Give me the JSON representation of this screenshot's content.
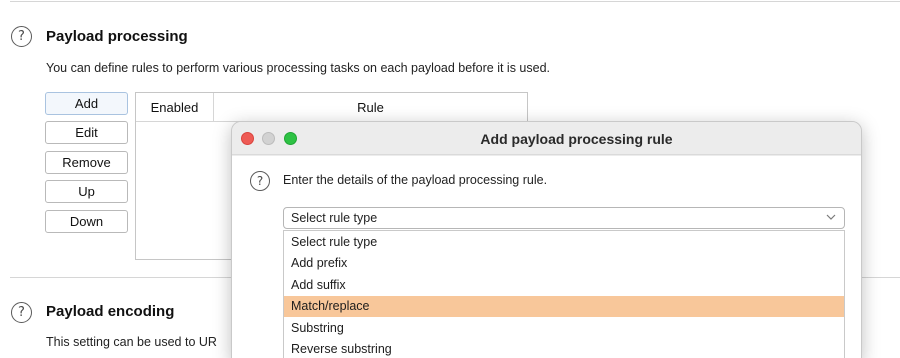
{
  "processing": {
    "title": "Payload processing",
    "description": "You can define rules to perform various processing tasks on each payload before it is used.",
    "buttons": [
      "Add",
      "Edit",
      "Remove",
      "Up",
      "Down"
    ],
    "table": {
      "columns": [
        "Enabled",
        "Rule"
      ]
    }
  },
  "encoding": {
    "title": "Payload encoding",
    "description": "This setting can be used to UR"
  },
  "dialog": {
    "title": "Add payload processing rule",
    "description": "Enter the details of the payload processing rule.",
    "select_value": "Select rule type",
    "options": [
      "Select rule type",
      "Add prefix",
      "Add suffix",
      "Match/replace",
      "Substring",
      "Reverse substring"
    ],
    "highlighted_option": "Match/replace",
    "highlight_color": "#f8c79a"
  },
  "icons": {
    "help": "?",
    "chevron": "chevron-down-icon"
  }
}
